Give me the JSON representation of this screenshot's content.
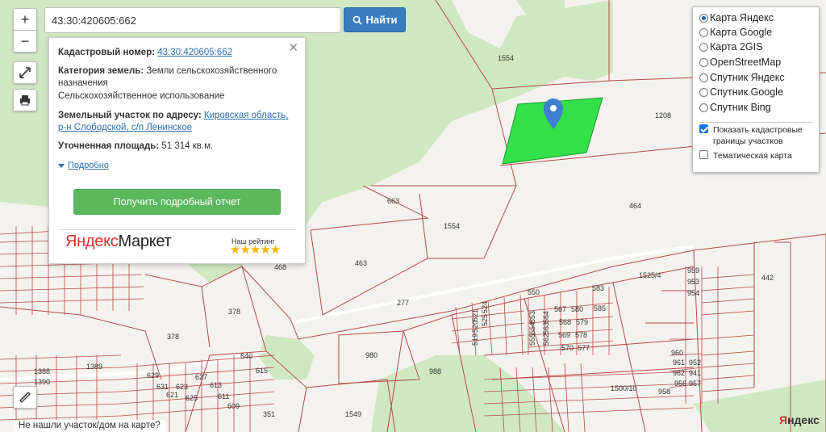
{
  "search": {
    "value": "43:30:420605:662",
    "button_label": "Найти"
  },
  "controls": {
    "zoom_in": "+",
    "zoom_out": "−"
  },
  "info_card": {
    "cadastral_label": "Кадастровый номер:",
    "cadastral_value": "43:30:420605:662",
    "category_label": "Категория земель:",
    "category_value": "Земли сельскохозяйственного назначения",
    "usage": "Сельскохозяйственное использование",
    "address_label": "Земельный участок по адресу:",
    "address_value": "Кировская область, р-н Слободской, с/п Ленинское",
    "area_label": "Уточненная площадь:",
    "area_value": "51 314 кв.м.",
    "details_link": "Подробно",
    "report_button": "Получить подробный отчет",
    "market_brand_ya": "Яндекс",
    "market_brand_rest": "Маркет",
    "rating_label": "Наш рейтинг",
    "rating_stars": "★★★★★"
  },
  "layers": {
    "options": [
      {
        "label": "Карта Яндекс",
        "selected": true
      },
      {
        "label": "Карта Google",
        "selected": false
      },
      {
        "label": "Карта 2GIS",
        "selected": false
      },
      {
        "label": "OpenStreetMap",
        "selected": false
      },
      {
        "label": "Спутник Яндекс",
        "selected": false
      },
      {
        "label": "Спутник Google",
        "selected": false
      },
      {
        "label": "Спутник Bing",
        "selected": false
      }
    ],
    "show_cadastral": {
      "label": "Показать кадастровые границы участков",
      "checked": true
    },
    "thematic": {
      "label": "Тематическая карта",
      "checked": false
    }
  },
  "map": {
    "parcel_labels": [
      "1554",
      "1208",
      "663",
      "1554",
      "464",
      "463",
      "468",
      "277",
      "1525/4",
      "442",
      "378",
      "378",
      "1389",
      "980",
      "988",
      "1500/10",
      "1549",
      "351",
      "550",
      "583",
      "585",
      "567",
      "580",
      "568",
      "579",
      "569",
      "578",
      "570",
      "577",
      "524",
      "525",
      "521",
      "520",
      "519",
      "553",
      "554",
      "555",
      "564",
      "563",
      "562",
      "959",
      "953",
      "954",
      "960",
      "961",
      "962",
      "941",
      "952",
      "957",
      "956",
      "958",
      "1388",
      "1390",
      "640",
      "615",
      "629",
      "631",
      "621",
      "623",
      "625",
      "627",
      "613",
      "611",
      "609"
    ],
    "highlight_color": "#33e04a",
    "marker_color": "#3f7fcf",
    "parcel_line_color": "#b84a4a",
    "copyright_ya": "Я",
    "copyright_rest": "ндекс"
  },
  "footer": {
    "not_found": "Не нашли участок/дом на карте?"
  }
}
